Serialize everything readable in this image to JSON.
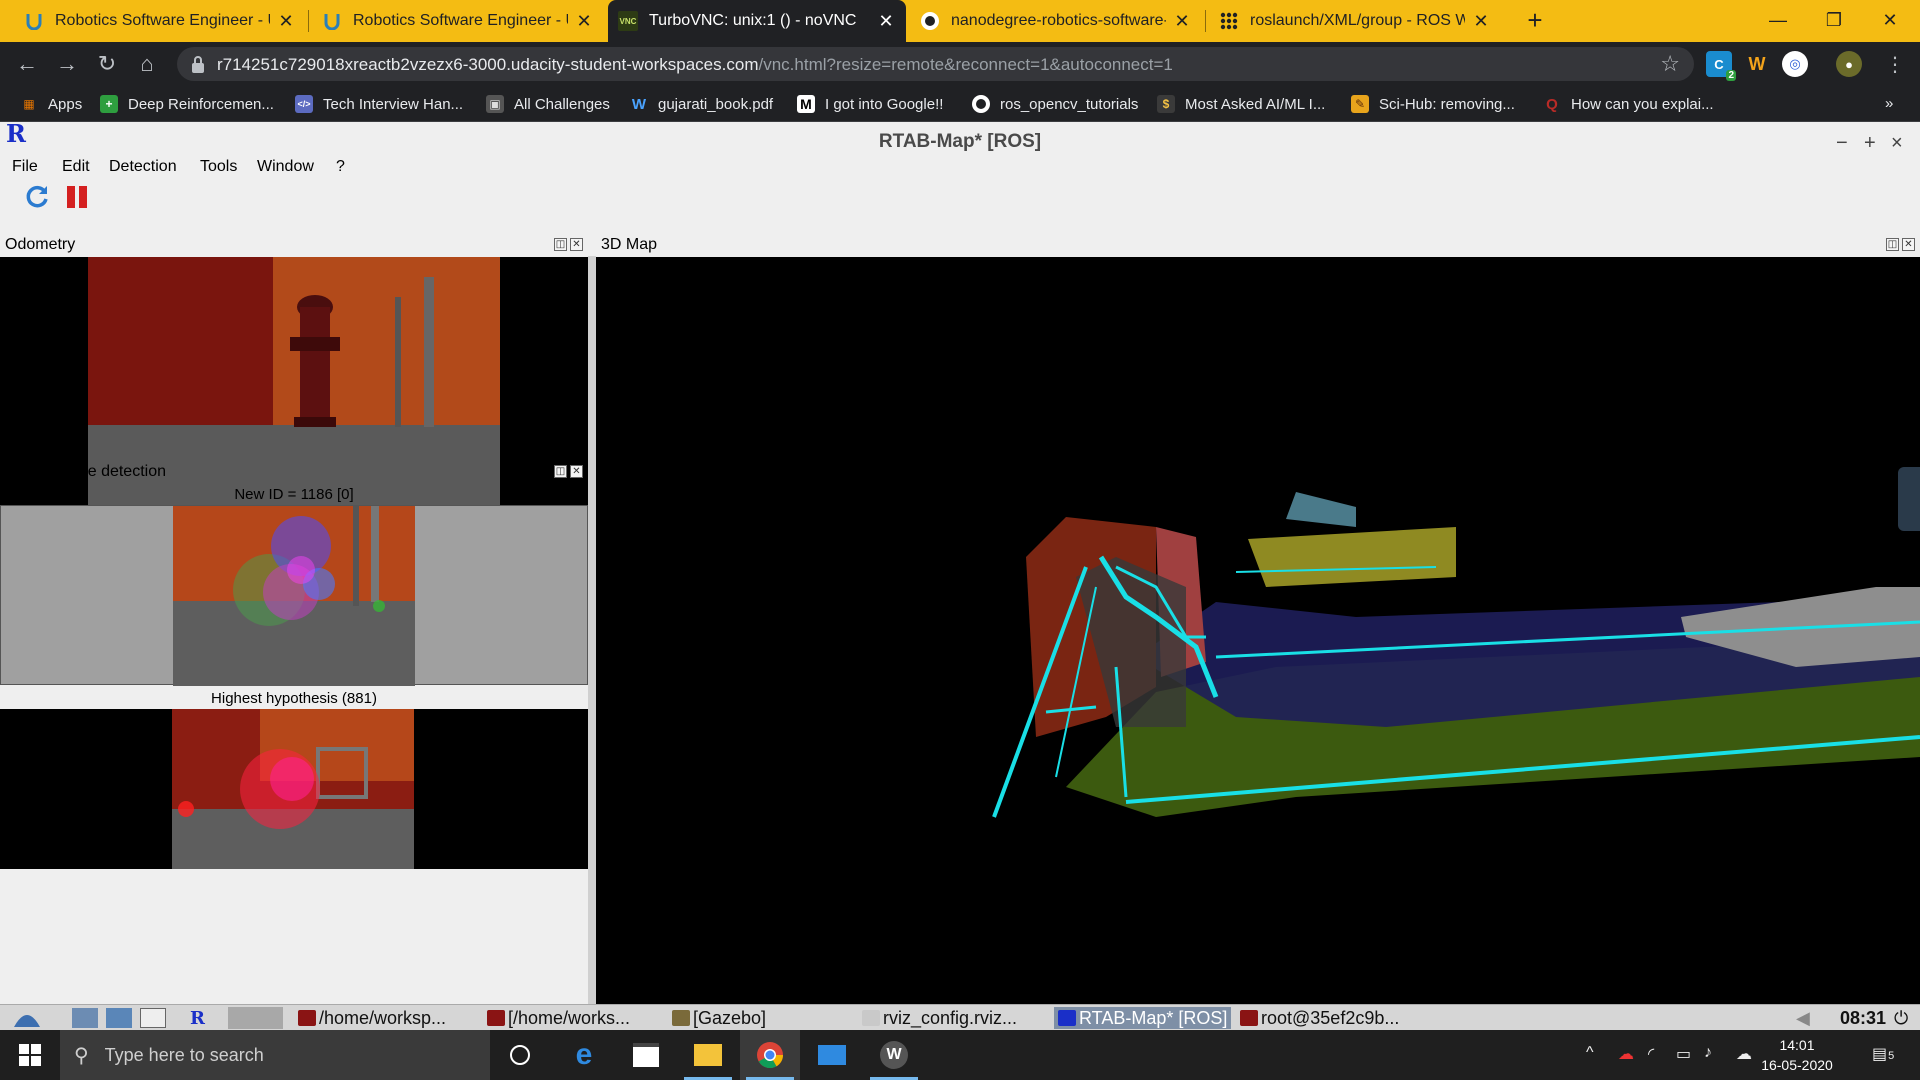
{
  "browser": {
    "tabs": [
      {
        "title": "Robotics Software Engineer - Ud",
        "favicon": "udacity-icon",
        "active": false
      },
      {
        "title": "Robotics Software Engineer - Ud",
        "favicon": "udacity-icon",
        "active": false
      },
      {
        "title": "TurboVNC: unix:1 () - noVNC",
        "favicon": "vnc-icon",
        "active": true
      },
      {
        "title": "nanodegree-robotics-software-e",
        "favicon": "github-icon",
        "active": false
      },
      {
        "title": "roslaunch/XML/group - ROS Wik",
        "favicon": "ros-wiki-icon",
        "active": false
      }
    ],
    "favicon_vnc_text": "VNC",
    "url_host": "r714251c729018xreactb2vzezx6-3000.udacity-student-workspaces.com",
    "url_path": "/vnc.html?resize=remote&reconnect=1&autoconnect=1",
    "extension_badge": "2",
    "bookmarks": [
      {
        "label": "Apps",
        "icon": "apps-grid-icon"
      },
      {
        "label": "Deep Reinforcemen...",
        "icon": "plus-green-icon"
      },
      {
        "label": "Tech Interview Han...",
        "icon": "code-icon"
      },
      {
        "label": "All Challenges",
        "icon": "challenges-icon"
      },
      {
        "label": "gujarati_book.pdf",
        "icon": "w-logo-icon"
      },
      {
        "label": "I got into Google!!",
        "icon": "medium-icon"
      },
      {
        "label": "ros_opencv_tutorials",
        "icon": "github-icon"
      },
      {
        "label": "Most Asked AI/ML I...",
        "icon": "dollar-icon"
      },
      {
        "label": "Sci-Hub: removing...",
        "icon": "scihub-icon"
      },
      {
        "label": "How can you explai...",
        "icon": "quora-icon"
      }
    ],
    "bookmarks_more": "»"
  },
  "app": {
    "logo": "R",
    "title": "RTAB-Map* [ROS]",
    "window_controls": [
      "−",
      "+",
      "×"
    ],
    "menu": [
      "File",
      "Edit",
      "Detection",
      "Tools",
      "Window",
      "?"
    ],
    "panels": {
      "odometry": "Odometry",
      "map3d": "3D Map",
      "loop": "Loop closure detection",
      "new_id": "New ID = 1186 [0]",
      "hypothesis": "Highest hypothesis (881)"
    }
  },
  "linux_taskbar": {
    "items": [
      "/home/worksp...",
      "[/home/works...",
      "[Gazebo]",
      "rviz_config.rviz...",
      "RTAB-Map* [ROS]",
      "root@35ef2c9b..."
    ],
    "time": "08:31"
  },
  "windows_taskbar": {
    "search_placeholder": "Type here to search",
    "time": "14:01",
    "date": "16-05-2020",
    "notification_count": "5"
  },
  "colors": {
    "chrome_tab_bg": "#f4bc13",
    "chrome_dark": "#202124",
    "point_cloud_cyan": "#19dfe6",
    "floor_green": "#4b6a14"
  }
}
